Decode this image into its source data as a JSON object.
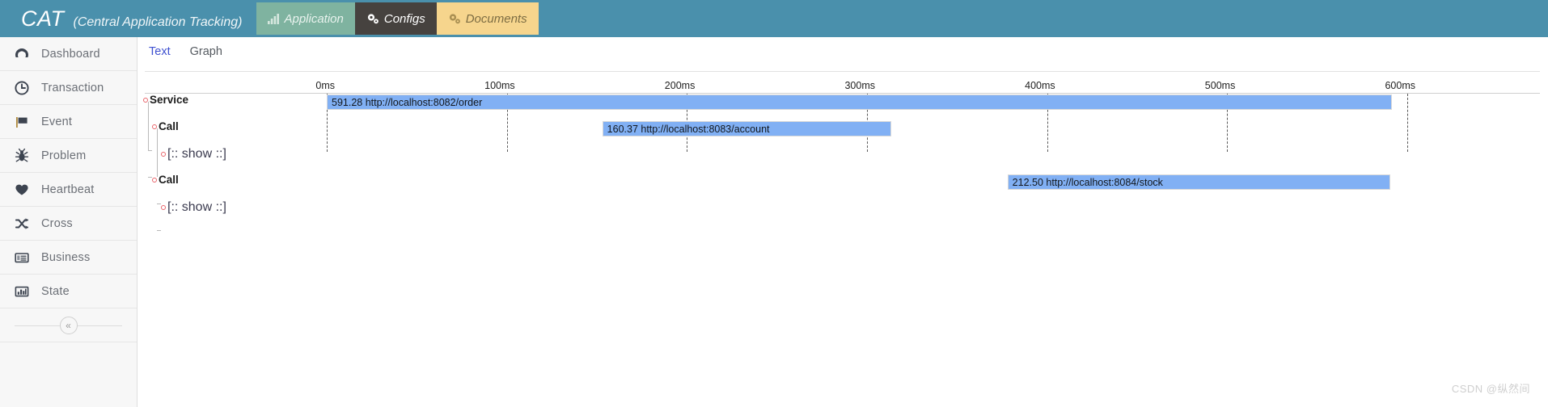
{
  "header": {
    "brand_acronym": "CAT",
    "brand_full": "(Central Application Tracking)",
    "nav_tabs": [
      {
        "label": "Application",
        "icon": "bar-chart-icon",
        "state": "inactive-green"
      },
      {
        "label": "Configs",
        "icon": "gears-icon",
        "state": "active-dark"
      },
      {
        "label": "Documents",
        "icon": "gears-icon",
        "state": "inactive-yellow"
      }
    ],
    "colors": {
      "bar_background": "#4a90ac",
      "application_tab": "#7fb3a0",
      "configs_tab": "#46423f",
      "documents_tab": "#f6d58d"
    }
  },
  "sidebar": {
    "items": [
      {
        "label": "Dashboard",
        "icon": "dashboard-icon"
      },
      {
        "label": "Transaction",
        "icon": "clock-icon"
      },
      {
        "label": "Event",
        "icon": "flag-icon"
      },
      {
        "label": "Problem",
        "icon": "bug-icon"
      },
      {
        "label": "Heartbeat",
        "icon": "heart-icon"
      },
      {
        "label": "Cross",
        "icon": "shuffle-icon"
      },
      {
        "label": "Business",
        "icon": "list-card-icon"
      },
      {
        "label": "State",
        "icon": "bar-chart-icon"
      }
    ],
    "collapse": {
      "glyph": "«",
      "name": "collapse-sidebar-button"
    }
  },
  "content": {
    "sub_tabs": [
      {
        "label": "Text",
        "active": true
      },
      {
        "label": "Graph",
        "active": false
      }
    ]
  },
  "chart_data": {
    "type": "bar",
    "title": "",
    "xlabel": "",
    "ylabel": "",
    "orientation": "horizontal-gantt",
    "grid": true,
    "xlim": [
      0,
      600
    ],
    "x_unit": "ms",
    "tick_labels": [
      "0ms",
      "100ms",
      "200ms",
      "300ms",
      "400ms",
      "500ms",
      "600ms"
    ],
    "tick_values": [
      0,
      100,
      200,
      300,
      400,
      500,
      600
    ],
    "tree": [
      {
        "depth": 0,
        "label": "Service",
        "style": "bold"
      },
      {
        "depth": 1,
        "label": "Call",
        "style": "bold"
      },
      {
        "depth": 2,
        "label": "[:: show ::]",
        "style": "normal"
      },
      {
        "depth": 1,
        "label": "Call",
        "style": "bold"
      },
      {
        "depth": 2,
        "label": "[:: show ::]",
        "style": "normal"
      }
    ],
    "bars": [
      {
        "row": 0,
        "duration_label": "591.28",
        "url": "http://localhost:8082/order",
        "label": "591.28 http://localhost:8082/order",
        "start_ms": 0,
        "end_ms": 591.28,
        "color": "#81b0f4"
      },
      {
        "row": 1,
        "duration_label": "160.37",
        "url": "http://localhost:8083/account",
        "label": "160.37 http://localhost:8083/account",
        "start_ms": 153,
        "end_ms": 313.37,
        "color": "#81b0f4"
      },
      {
        "row": 3,
        "duration_label": "212.50",
        "url": "http://localhost:8084/stock",
        "label": "212.50 http://localhost:8084/stock",
        "start_ms": 378,
        "end_ms": 590.5,
        "color": "#81b0f4"
      }
    ]
  },
  "watermark": "CSDN @纵然间"
}
